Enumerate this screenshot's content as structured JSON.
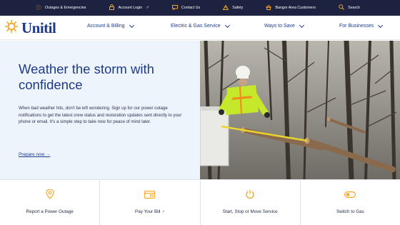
{
  "utility_bar": {
    "items": [
      {
        "label": "Outages & Emergencies",
        "icon": "info-circle-icon",
        "external": false
      },
      {
        "label": "Account Login",
        "icon": "lock-icon",
        "external": true
      },
      {
        "label": "Contact Us",
        "icon": "chat-icon",
        "external": false
      },
      {
        "label": "Safety",
        "icon": "warning-icon",
        "external": false
      },
      {
        "label": "Bangor Area Customers",
        "icon": "house-icon",
        "external": false
      },
      {
        "label": "Search",
        "icon": "search-icon",
        "external": false
      }
    ],
    "external_glyph": "↗"
  },
  "brand": {
    "name": "Unitil"
  },
  "main_nav": {
    "items": [
      {
        "label": "Account & Billing"
      },
      {
        "label": "Electric & Gas Service"
      },
      {
        "label": "Ways to Save"
      },
      {
        "label": "For Businesses"
      }
    ]
  },
  "hero": {
    "title": "Weather the storm with confidence",
    "body": "When bad weather hits, don't be left wondering. Sign up for our power outage notifications to get the latest crew status and restoration updates sent directly to your phone or email. It's a simple step to take now for peace of mind later.",
    "link_label": "Prepare now →",
    "image_description": "utility-worker-cutting-tree-branch-photo"
  },
  "quick_actions": [
    {
      "label": "Report a Power Outage",
      "icon": "location-pin-icon",
      "external": false
    },
    {
      "label": "Pay Your Bill",
      "icon": "bill-icon",
      "external": true
    },
    {
      "label": "Start, Stop or Move Service",
      "icon": "power-icon",
      "external": false
    },
    {
      "label": "Switch to Gas",
      "icon": "toggle-icon",
      "external": false
    }
  ],
  "colors": {
    "utility_bg": "#1c2240",
    "brand_blue": "#1e3a8a",
    "accent_orange": "#f5a623",
    "hero_bg": "#eef4fb"
  }
}
